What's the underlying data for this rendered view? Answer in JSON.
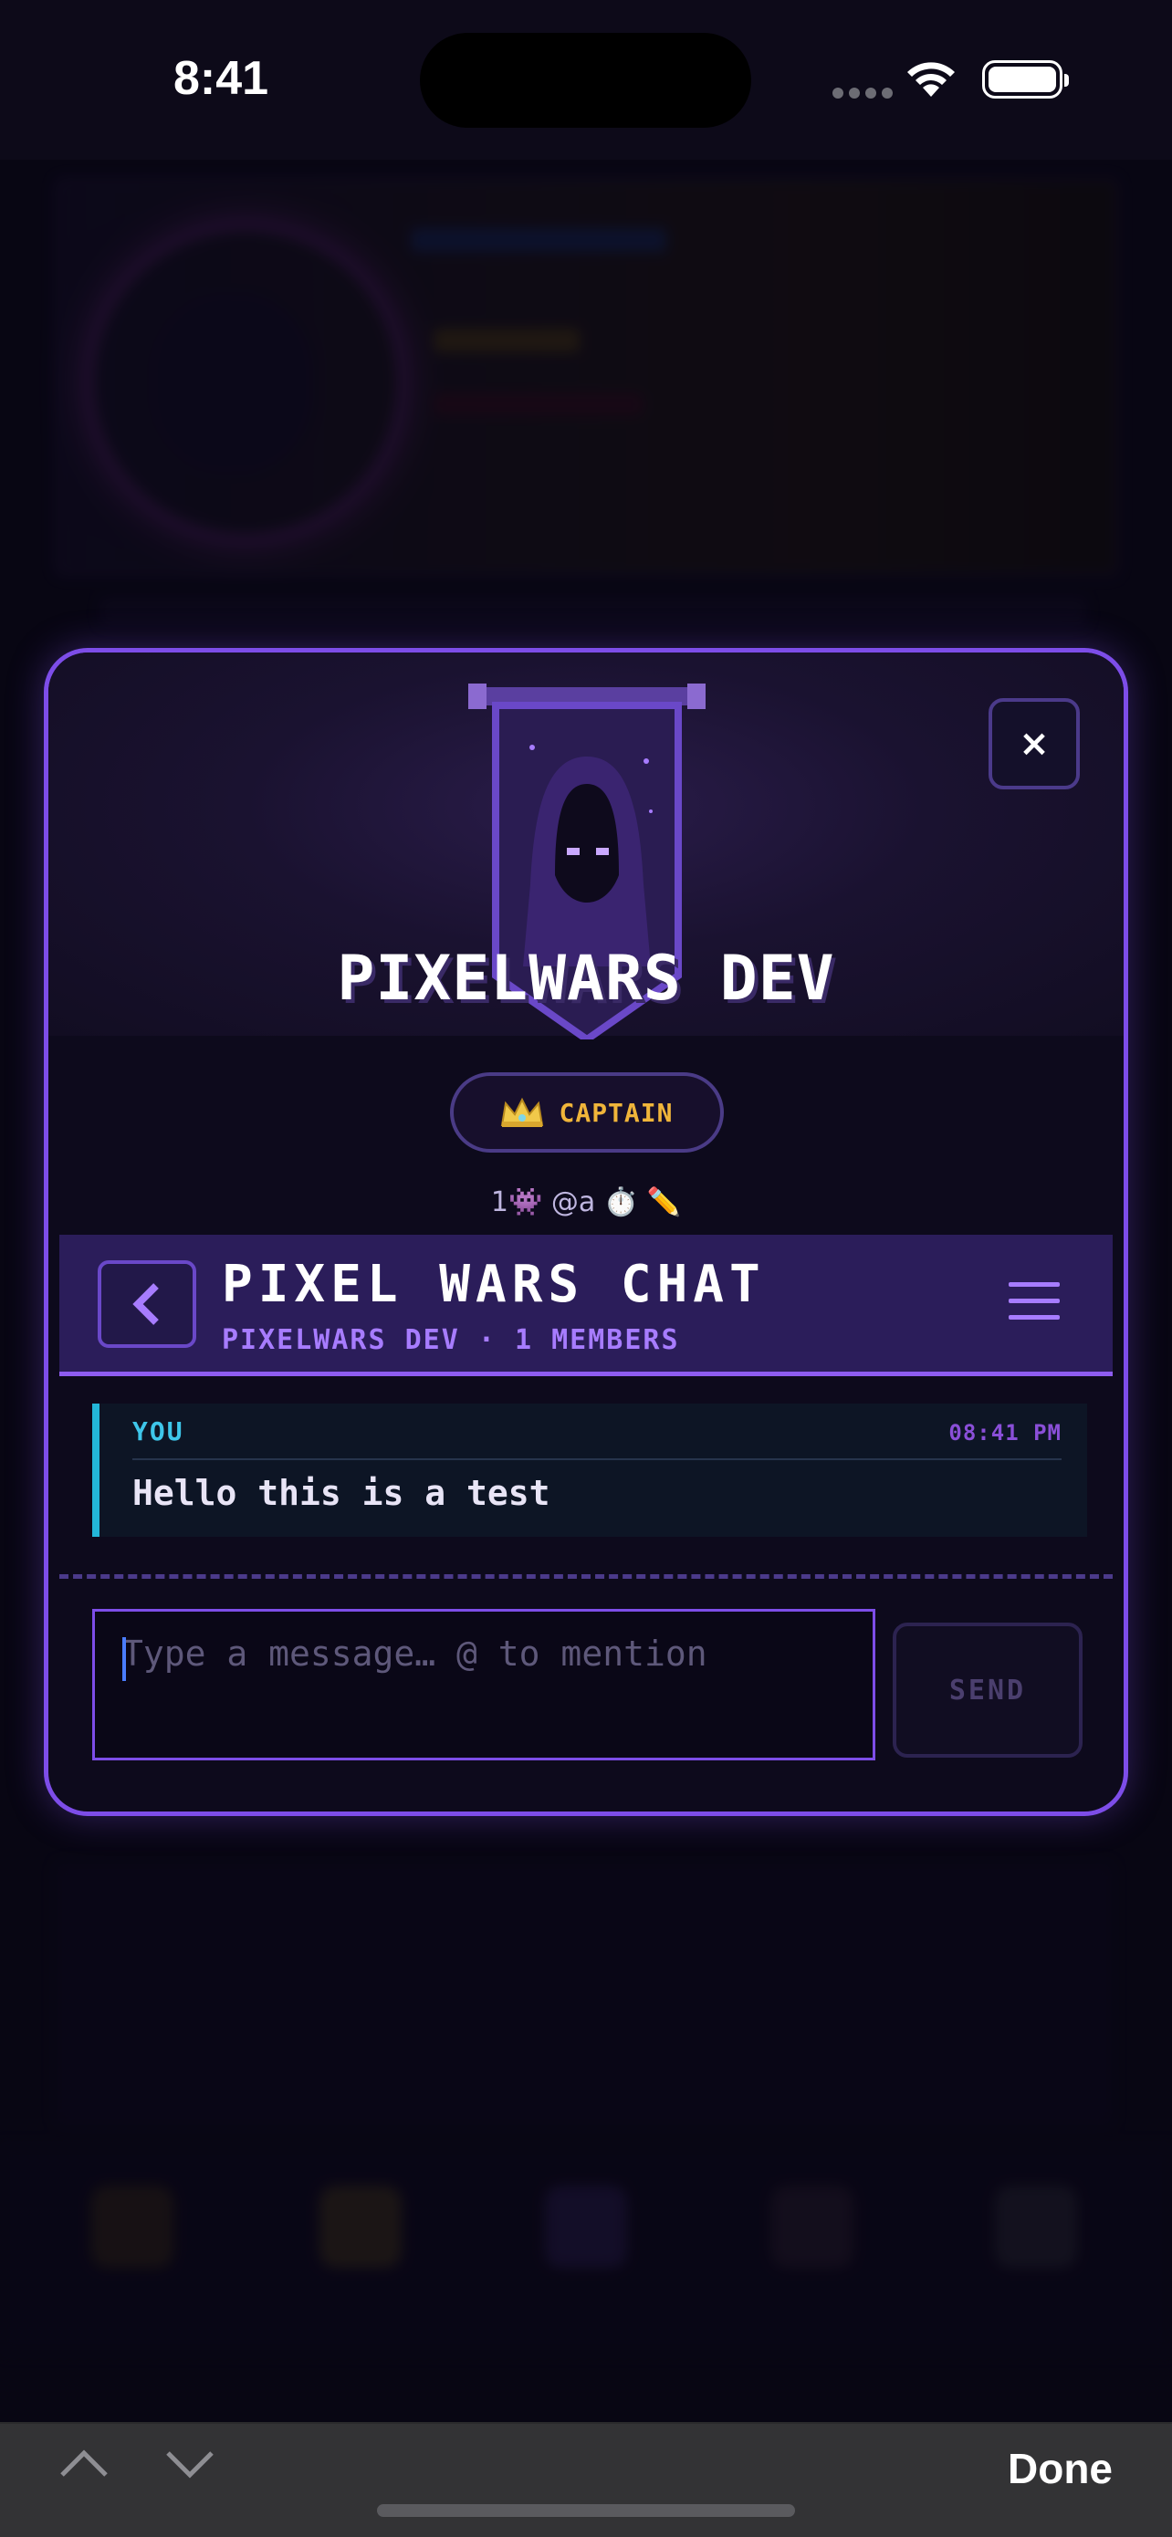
{
  "status_bar": {
    "time": "8:41"
  },
  "modal": {
    "close_label": "×",
    "clan_name": "PIXELWARS DEV",
    "role_badge": {
      "icon": "crown-icon",
      "label": "CAPTAIN"
    },
    "badges_text": "1👾 @a ⏱️ ✏️"
  },
  "chat": {
    "title": "PIXEL WARS CHAT",
    "subtitle": "PIXELWARS DEV · 1 MEMBERS",
    "messages": [
      {
        "author": "YOU",
        "time": "08:41 PM",
        "text": "Hello this is a test"
      }
    ],
    "input": {
      "value": "",
      "placeholder": "Type a message… @ to mention"
    },
    "send_label": "SEND"
  },
  "accessory_bar": {
    "done_label": "Done"
  },
  "colors": {
    "accent": "#7d4de8",
    "accent_light": "#a77cff",
    "captain_gold": "#f0b53a",
    "message_accent": "#23b6d8",
    "background": "#0c0918"
  }
}
